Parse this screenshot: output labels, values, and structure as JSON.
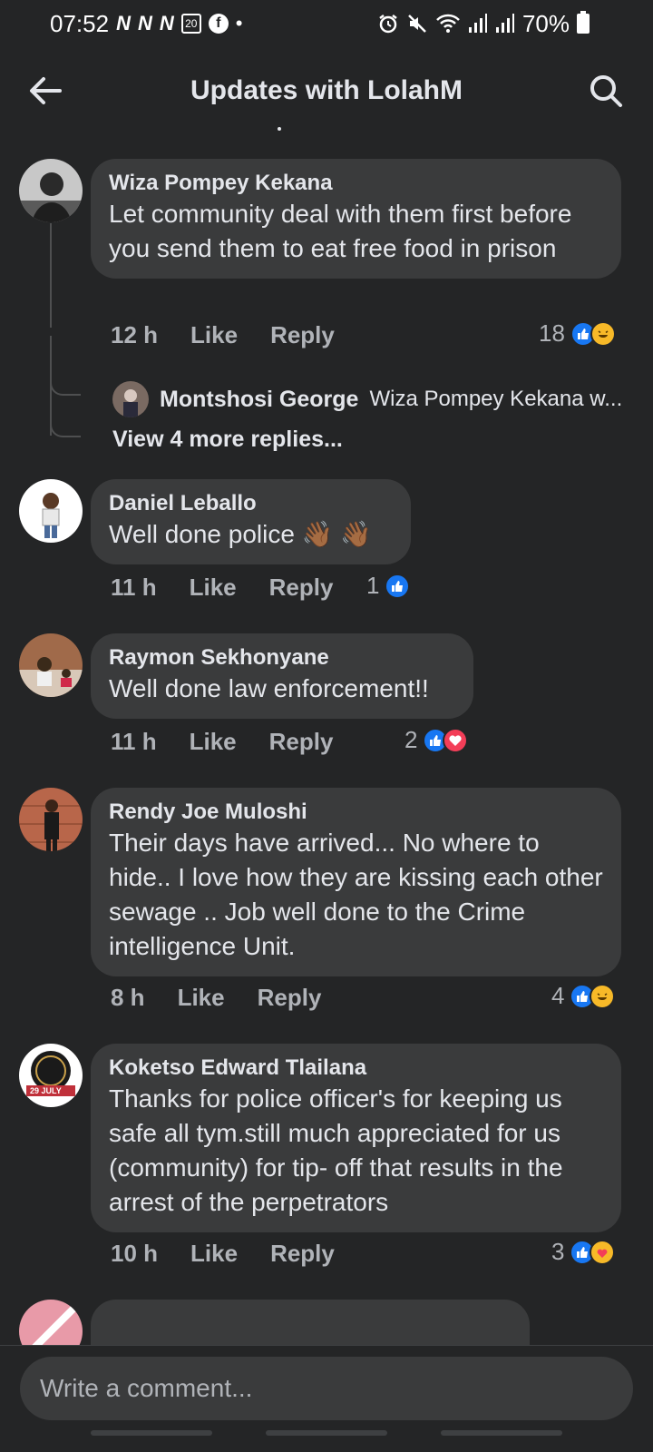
{
  "status": {
    "time": "07:52",
    "notif_n1": "N",
    "notif_n2": "N",
    "notif_n3": "N",
    "calendar_day": "20",
    "facebook_glyph": "f",
    "dot": "•",
    "battery": "70%"
  },
  "header": {
    "title": "Updates with LolahM"
  },
  "comments": [
    {
      "author": "Wiza Pompey Kekana",
      "text": "Let community deal with them first before you send them to eat free food in prison",
      "time": "12 h",
      "like": "Like",
      "reply": "Reply",
      "reaction_count": "18",
      "reactions": [
        "like-icon",
        "haha-icon"
      ]
    },
    {
      "author": "Daniel Leballo",
      "text": "Well done police 👋🏾 👋🏾",
      "time": "11 h",
      "like": "Like",
      "reply": "Reply",
      "reaction_count": "1",
      "reactions": [
        "like-icon"
      ]
    },
    {
      "author": "Raymon Sekhonyane",
      "text": "Well done law enforcement!!",
      "time": "11 h",
      "like": "Like",
      "reply": "Reply",
      "reaction_count": "2",
      "reactions": [
        "like-icon",
        "love-icon"
      ]
    },
    {
      "author": "Rendy Joe Muloshi",
      "text": "Their days have arrived... No where to hide.. I love how they are kissing each other sewage .. Job well done to the Crime intelligence Unit.",
      "time": "8 h",
      "like": "Like",
      "reply": "Reply",
      "reaction_count": "4",
      "reactions": [
        "like-icon",
        "haha-icon"
      ]
    },
    {
      "author": "Koketso Edward Tlailana",
      "text": "Thanks for police  officer's for keeping us safe all tym.still much appreciated for us (community) for tip- off that results in the arrest of the perpetrators",
      "time": "10 h",
      "like": "Like",
      "reply": "Reply",
      "reaction_count": "3",
      "reactions": [
        "like-icon",
        "care-icon"
      ]
    }
  ],
  "thread": {
    "reply_author": "Montshosi George",
    "reply_text": "Wiza Pompey Kekana w...",
    "more_replies": "View 4 more replies..."
  },
  "avatar_badge": {
    "label": "29 JULY"
  },
  "composer": {
    "placeholder": "Write a comment..."
  },
  "colors": {
    "background": "#242526",
    "bubble": "#3a3b3c",
    "like_blue": "#1877f2",
    "text": "#e4e6eb",
    "muted": "#b0b3b8"
  }
}
